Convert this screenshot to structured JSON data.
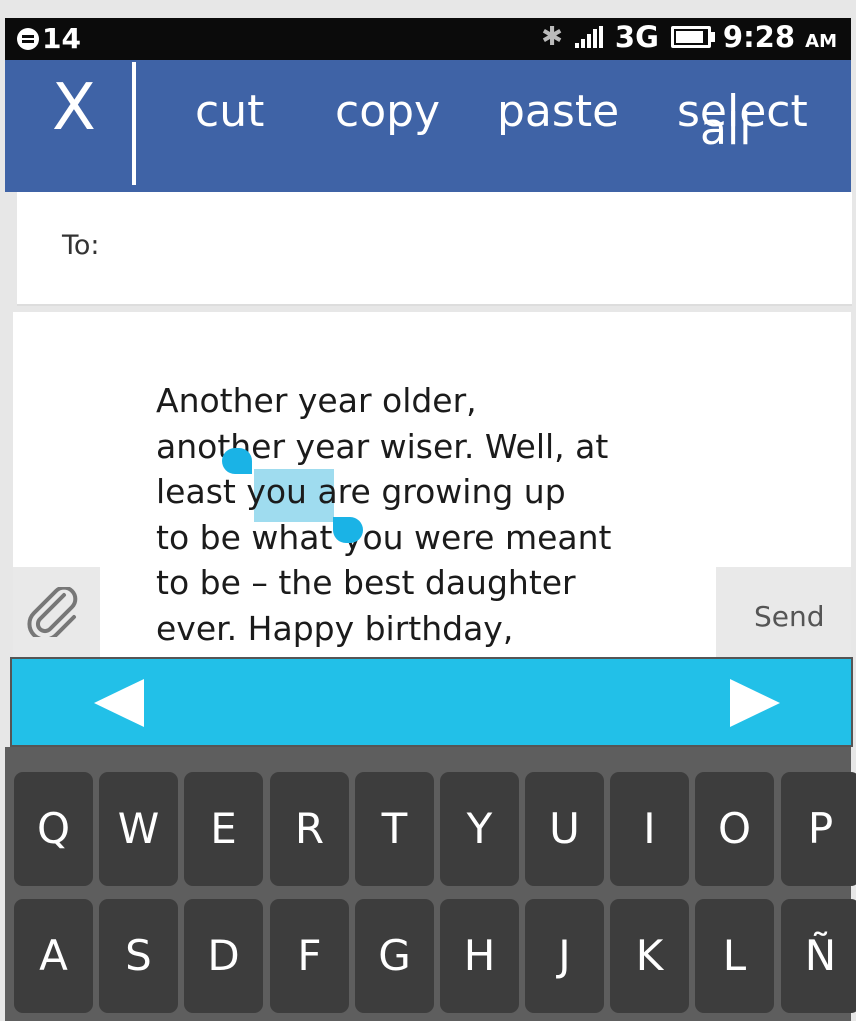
{
  "status_bar": {
    "notification_count": "14",
    "network": "3G",
    "time": "9:28",
    "ampm": "AM",
    "battery_level": 0.9
  },
  "action_bar": {
    "close_label": "X",
    "cut_label": "cut",
    "copy_label": "copy",
    "paste_label": "paste",
    "select_all_line1": "select",
    "select_all_line2": "all"
  },
  "recipient": {
    "label": "To:",
    "value": ""
  },
  "message": {
    "before_selection": "Another year older,\nanother year wiser. Well, at\nleast ",
    "selected": "you",
    "after_selection": " are growing up\nto be what you were meant\nto be – the best daughter\never. Happy birthday,"
  },
  "compose_actions": {
    "attach_icon": "paperclip-icon",
    "send_label": "Send"
  },
  "keyboard": {
    "row1": [
      "Q",
      "W",
      "E",
      "R",
      "T",
      "Y",
      "U",
      "I",
      "O",
      "P"
    ],
    "row2": [
      "A",
      "S",
      "D",
      "F",
      "G",
      "H",
      "J",
      "K",
      "L",
      "Ñ"
    ]
  },
  "colors": {
    "action_bar": "#3f63a6",
    "accent": "#22c0e8",
    "selection": "#9fdcef",
    "key_background": "#3d3d3d",
    "keyboard_background": "#5e5e5e"
  }
}
